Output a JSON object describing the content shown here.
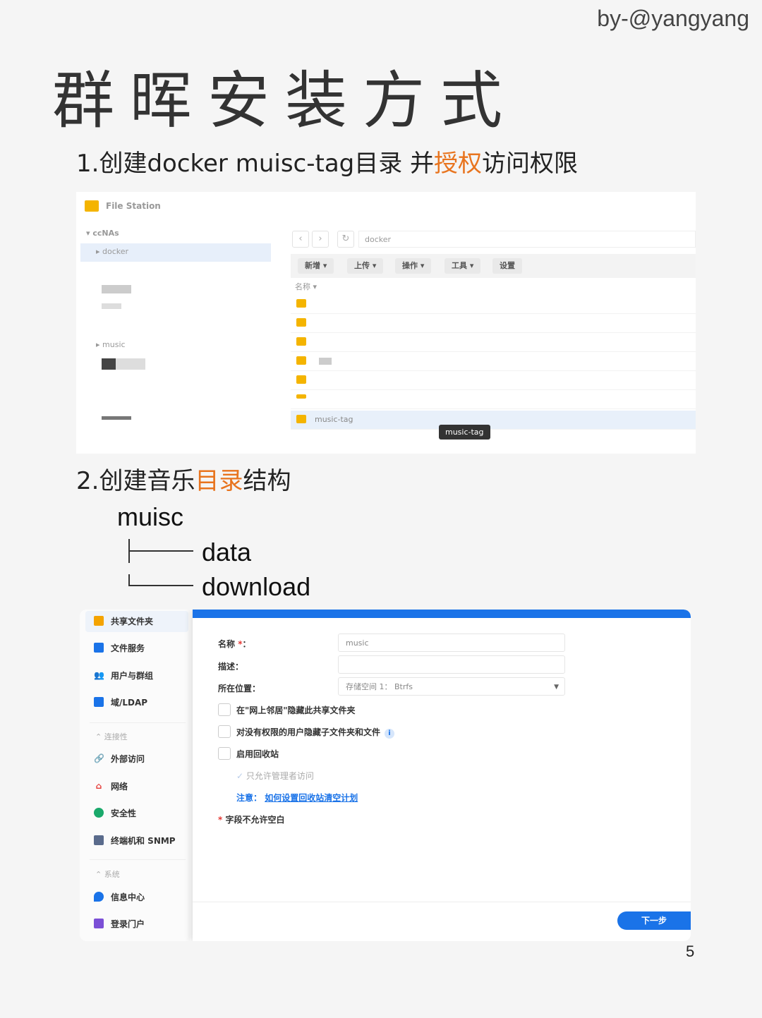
{
  "author": "by-@yangyang",
  "title": "群晖安装方式",
  "step1": {
    "prefix": "1.创建docker muisc-tag目录 并",
    "highlight": "授权",
    "suffix": "访问权限"
  },
  "file_station": {
    "app_name": "File Station",
    "tree": {
      "root": "ccNAs",
      "selected": "docker",
      "music": "music"
    },
    "path": "docker",
    "toolbar": [
      "新增",
      "上传",
      "操作",
      "工具",
      "设置"
    ],
    "column_name": "名称",
    "selected_row": "music-tag",
    "tooltip": "music-tag"
  },
  "step2": {
    "prefix": "2.创建音乐",
    "highlight": "目录",
    "suffix": "结构"
  },
  "dir_tree": {
    "root": "muisc",
    "children": [
      "data",
      "download"
    ]
  },
  "control_panel": {
    "sidebar": {
      "items_top": [
        "共享文件夹",
        "文件服务",
        "用户与群组",
        "域/LDAP"
      ],
      "section_connectivity": "连接性",
      "items_mid": [
        "外部访问",
        "网络",
        "安全性",
        "终端机和 SNMP"
      ],
      "section_system": "系统",
      "items_bottom": [
        "信息中心",
        "登录门户"
      ]
    },
    "form": {
      "name_label": "名称",
      "name_value": "music",
      "desc_label": "描述",
      "location_label": "所在位置",
      "location_value": "存储空间 1： Btrfs",
      "check1": "在\"网上邻居\"隐藏此共享文件夹",
      "check2": "对没有权限的用户隐藏子文件夹和文件",
      "check3": "启用回收站",
      "sub_check": "只允许管理者访问",
      "note_prefix": "注意：",
      "note_link": "如何设置回收站清空计划",
      "warning": "字段不允许空白",
      "next_button": "下一步"
    }
  },
  "page_number": "5",
  "colors": {
    "accent": "#e8741e",
    "blue": "#1a73e8"
  }
}
